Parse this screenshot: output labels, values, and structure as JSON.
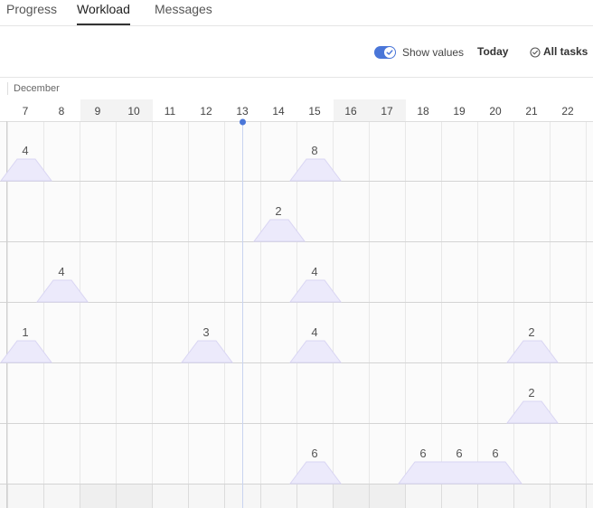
{
  "tabs": [
    {
      "label": "Progress",
      "active": false
    },
    {
      "label": "Workload",
      "active": true
    },
    {
      "label": "Messages",
      "active": false
    }
  ],
  "toolbar": {
    "show_values_label": "Show values",
    "show_values_on": true,
    "today_label": "Today",
    "all_tasks_label": "All tasks",
    "all_tasks_icon": "check-circle-icon"
  },
  "calendar": {
    "month": "December",
    "days": [
      7,
      8,
      9,
      10,
      11,
      12,
      13,
      14,
      15,
      16,
      17,
      18,
      19,
      20,
      21,
      22
    ],
    "weekend_days": [
      9,
      10,
      16,
      17
    ],
    "today": 13
  },
  "workload": {
    "rows": [
      {
        "entries": [
          {
            "start": 7,
            "end": 7,
            "value": 4
          },
          {
            "start": 15,
            "end": 15,
            "value": 8
          }
        ]
      },
      {
        "entries": [
          {
            "start": 14,
            "end": 14,
            "value": 2
          }
        ]
      },
      {
        "entries": [
          {
            "start": 8,
            "end": 8,
            "value": 4
          },
          {
            "start": 15,
            "end": 15,
            "value": 4
          }
        ]
      },
      {
        "entries": [
          {
            "start": 7,
            "end": 7,
            "value": 1
          },
          {
            "start": 12,
            "end": 12,
            "value": 3
          },
          {
            "start": 15,
            "end": 15,
            "value": 4
          },
          {
            "start": 21,
            "end": 21,
            "value": 2
          }
        ]
      },
      {
        "entries": [
          {
            "start": 21,
            "end": 21,
            "value": 2
          }
        ]
      },
      {
        "entries": [
          {
            "start": 15,
            "end": 15,
            "value": 6
          },
          {
            "start": 18,
            "end": 20,
            "value": 6
          }
        ]
      }
    ]
  },
  "colors": {
    "accent": "#4a76d8",
    "bar_fill": "#eceafb",
    "bar_stroke": "#d9d5f3",
    "weekend": "#f3f3f3",
    "today_line": "#c9d4f0"
  }
}
